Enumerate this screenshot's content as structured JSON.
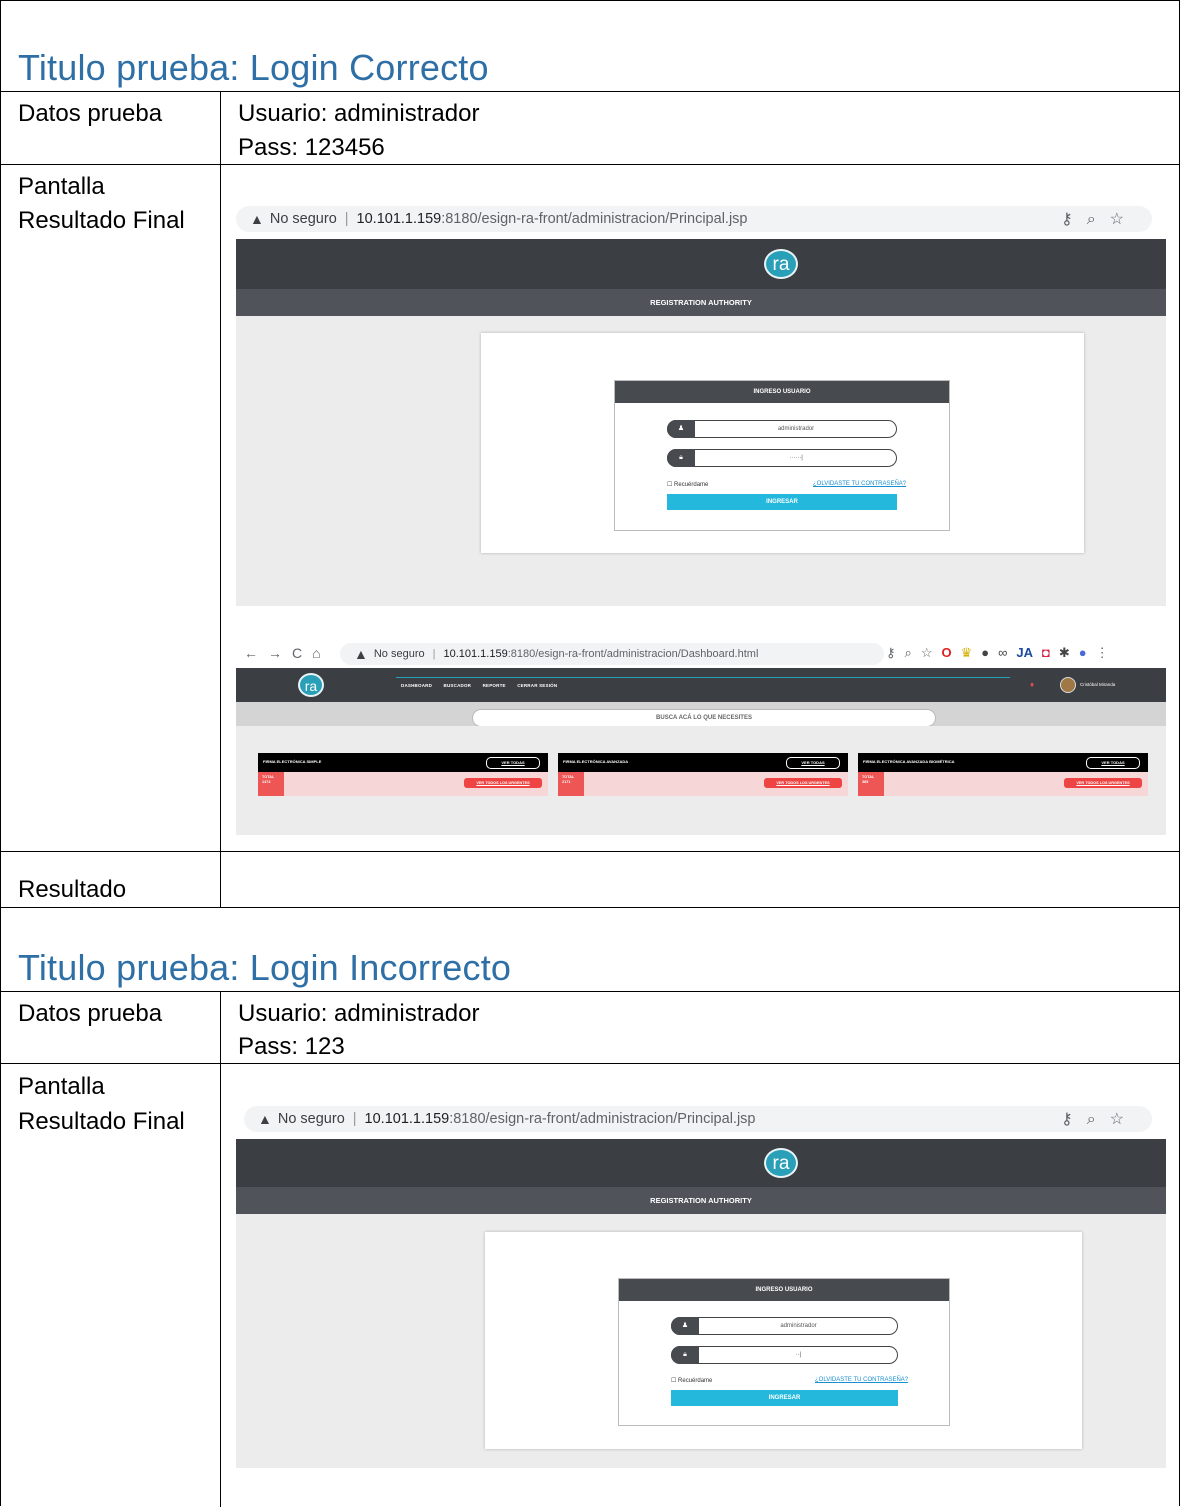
{
  "sections": [
    {
      "title": "Titulo prueba: Login Correcto",
      "datos_label": "Datos prueba",
      "usuario": "Usuario: administrador",
      "pass": "Pass: 123456",
      "pantalla_label_1": "Pantalla",
      "pantalla_label_2": "Resultado Final",
      "resultado_label": "Resultado",
      "shot_login": {
        "security": "No seguro",
        "host": "10.101.1.159",
        "path": ":8180/esign-ra-front/administracion/Principal.jsp",
        "logo": "ra",
        "subtitle": "REGISTRATION AUTHORITY",
        "login_title": "INGRESO USUARIO",
        "user_value": "administrador",
        "pass_value": "······|",
        "remember": "☐ Recuérdame",
        "forgot": "¿OLVIDASTE TU CONTRASEÑA?",
        "button": "INGRESAR"
      },
      "shot_dashboard": {
        "security": "No seguro",
        "host": "10.101.1.159",
        "path": ":8180/esign-ra-front/administracion/Dashboard.html",
        "logo": "ra",
        "nav": [
          "DASHBOARD",
          "BUSCADOR",
          "REPORTE",
          "CERRAR SESIÓN"
        ],
        "user": "Cristóbal Miranda",
        "search": "BUSCA ACÁ LO QUE NECESITES",
        "panels": [
          {
            "title": "FIRMA ELECTRÓNICA SIMPLE",
            "btn": "VER TODAS",
            "total_label": "TOTAL",
            "total": "1474",
            "urgent": "VER TODOS LOS URGENTES"
          },
          {
            "title": "FIRMA ELECTRÓNICA AVANZADA",
            "btn": "VER TODAS",
            "total_label": "TOTAL",
            "total": "2171",
            "urgent": "VER TODOS LOS URGENTES"
          },
          {
            "title": "FIRMA ELECTRÓNICA AVANZADA BIOMÉTRICA",
            "btn": "VER TODAS",
            "total_label": "TOTAL",
            "total": "385",
            "urgent": "VER TODOS LOS URGENTES"
          }
        ]
      }
    },
    {
      "title": "Titulo prueba: Login Incorrecto",
      "datos_label": "Datos prueba",
      "usuario": "Usuario: administrador",
      "pass": "Pass: 123",
      "pantalla_label_1": "Pantalla",
      "pantalla_label_2": "Resultado Final",
      "shot_login": {
        "security": "No seguro",
        "host": "10.101.1.159",
        "path": ":8180/esign-ra-front/administracion/Principal.jsp",
        "logo": "ra",
        "subtitle": "REGISTRATION AUTHORITY",
        "login_title": "INGRESO USUARIO",
        "user_value": "administrador",
        "pass_value": "··|",
        "remember": "☐ Recuérdame",
        "forgot": "¿OLVIDASTE TU CONTRASEÑA?",
        "button": "INGRESAR"
      }
    }
  ]
}
